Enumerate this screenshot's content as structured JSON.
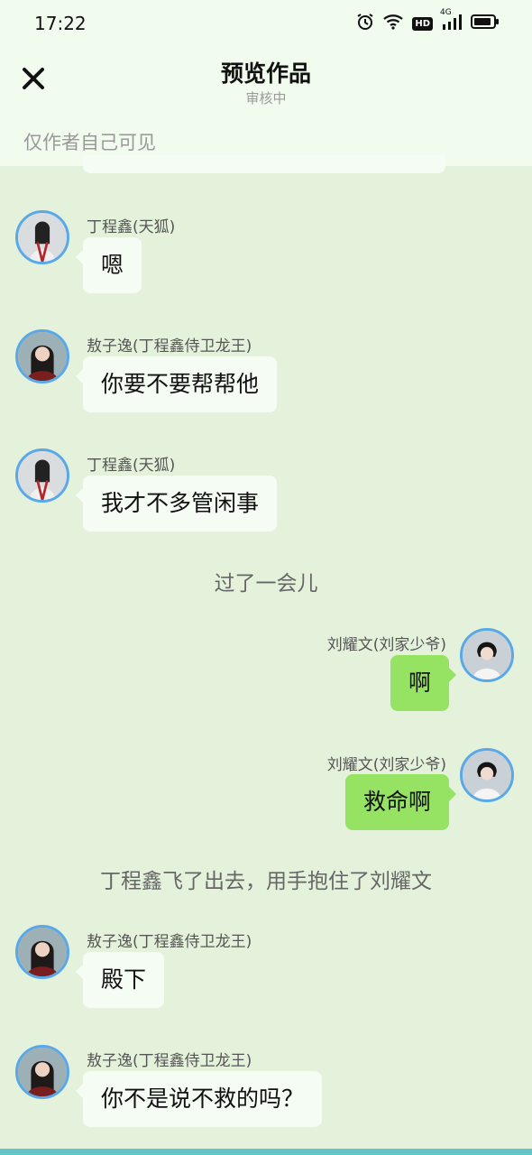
{
  "status": {
    "time": "17:22",
    "hd": "HD",
    "network": "4G"
  },
  "header": {
    "title": "预览作品",
    "subtitle": "审核中",
    "note": "仅作者自己可见"
  },
  "messages": [
    {
      "speaker": "丁程鑫(天狐)",
      "text": "嗯",
      "side": "left",
      "avatar": "dcx-avatar"
    },
    {
      "speaker": "敖子逸(丁程鑫侍卫龙王)",
      "text": "你要不要帮帮他",
      "side": "left",
      "avatar": "azy-avatar"
    },
    {
      "speaker": "丁程鑫(天狐)",
      "text": "我才不多管闲事",
      "side": "left",
      "avatar": "dcx-avatar"
    },
    {
      "narration": "过了一会儿"
    },
    {
      "speaker": "刘耀文(刘家少爷)",
      "text": "啊",
      "side": "right",
      "avatar": "lyw-avatar"
    },
    {
      "speaker": "刘耀文(刘家少爷)",
      "text": "救命啊",
      "side": "right",
      "avatar": "lyw-avatar"
    },
    {
      "narration": "丁程鑫飞了出去，用手抱住了刘耀文"
    },
    {
      "speaker": "敖子逸(丁程鑫侍卫龙王)",
      "text": "殿下",
      "side": "left",
      "avatar": "azy-avatar"
    },
    {
      "speaker": "敖子逸(丁程鑫侍卫龙王)",
      "text": "你不是说不救的吗？",
      "side": "left",
      "avatar": "azy-avatar"
    }
  ],
  "colors": {
    "background": "#e4f2dc",
    "header": "#f1fbee",
    "bubble_left": "#f5fcf3",
    "bubble_right": "#96e262",
    "avatar_border": "#5aa8e8"
  }
}
